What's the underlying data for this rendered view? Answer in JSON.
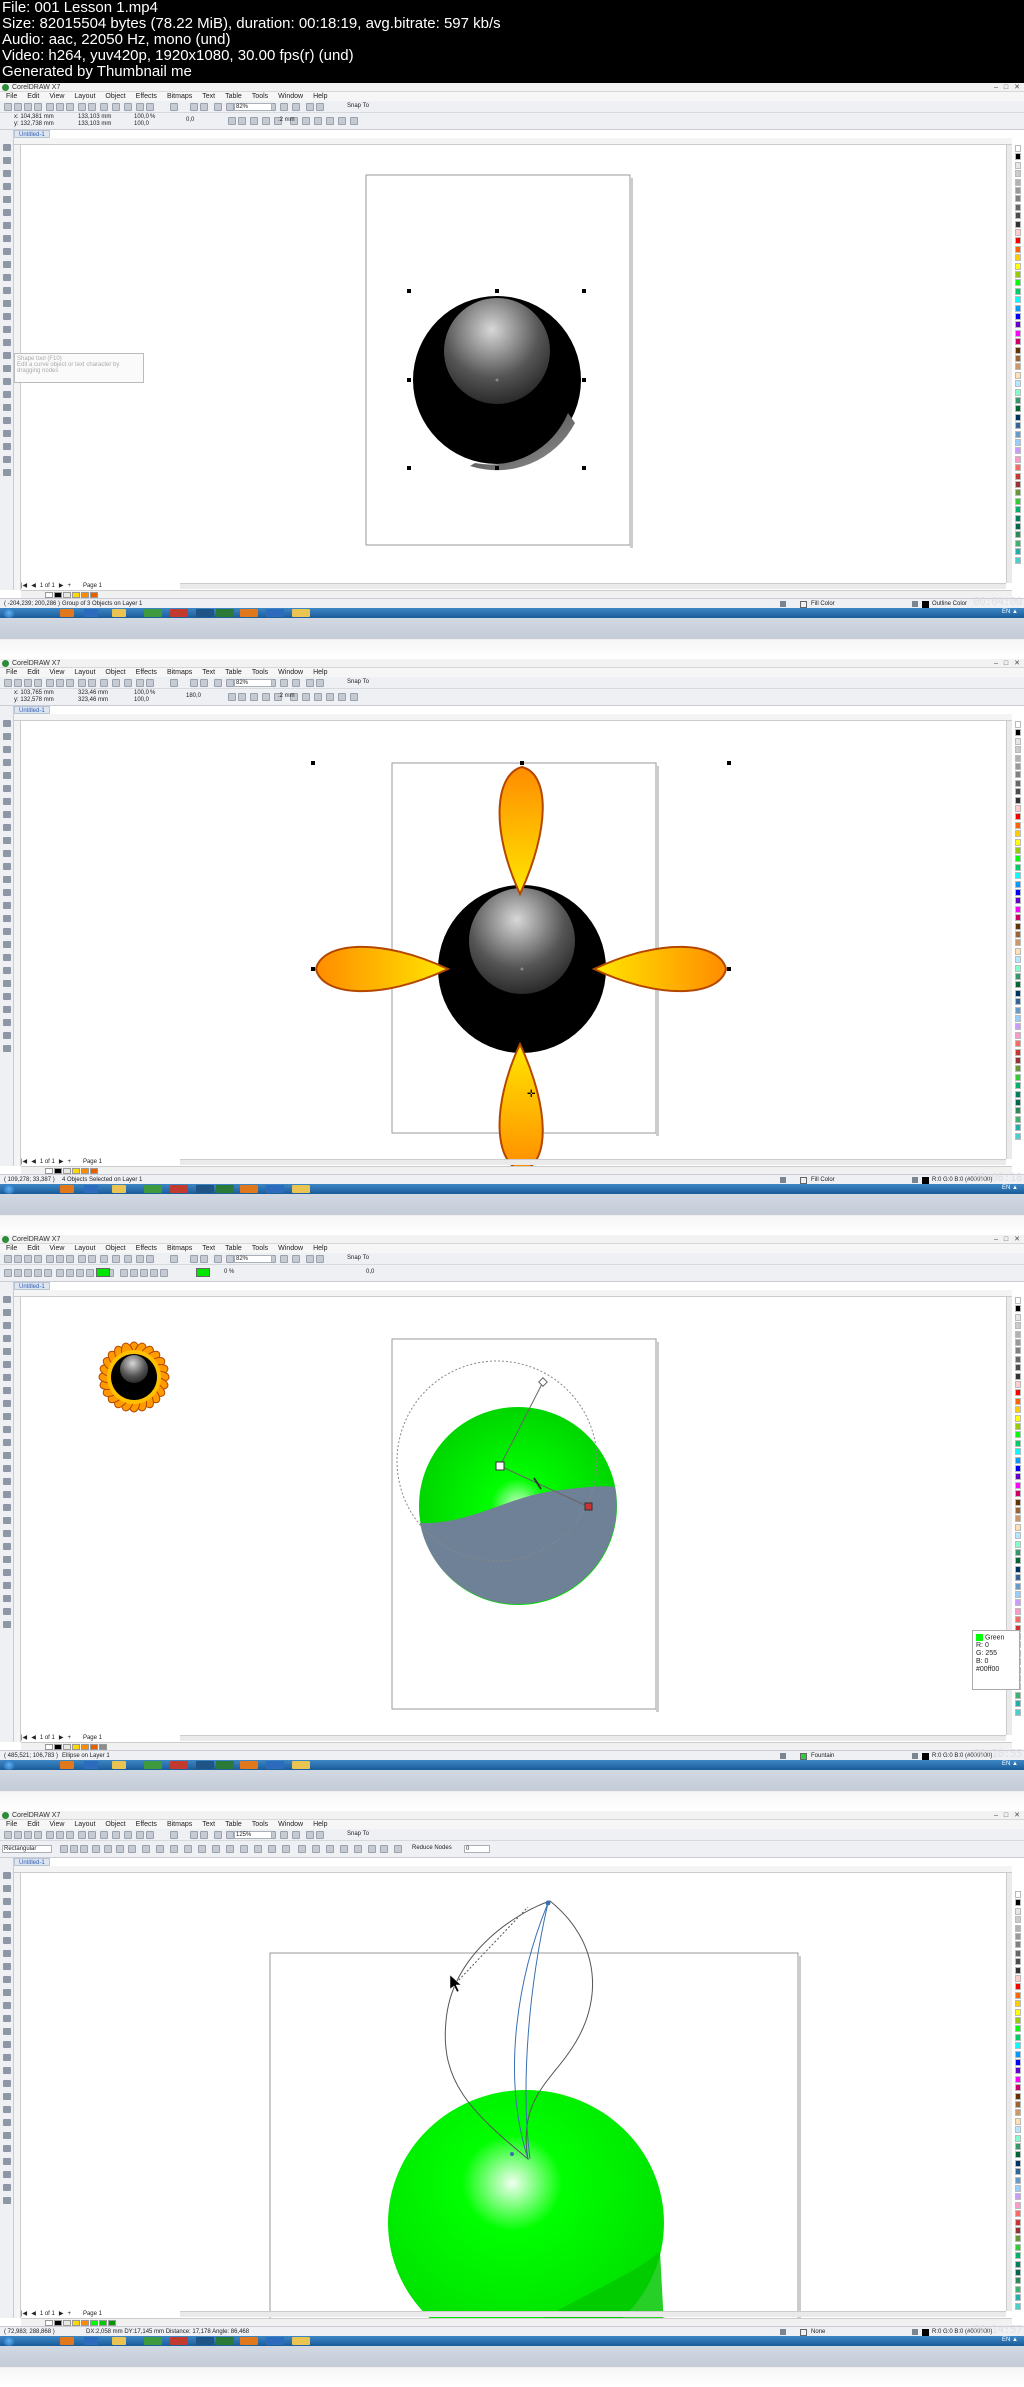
{
  "header": {
    "file": "File: 001 Lesson 1.mp4",
    "size": "Size: 82015504 bytes (78.22 MiB), duration: 00:18:19, avg.bitrate: 597 kb/s",
    "audio": "Audio: aac, 22050 Hz, mono (und)",
    "video": "Video: h264, yuv420p, 1920x1080, 30.00 fps(r) (und)",
    "generated": "Generated by Thumbnail me"
  },
  "app": {
    "title": "CorelDRAW X7",
    "menu": [
      "File",
      "Edit",
      "View",
      "Layout",
      "Object",
      "Effects",
      "Bitmaps",
      "Text",
      "Table",
      "Tools",
      "Window",
      "Help"
    ],
    "doc_tab": "Untitled-1",
    "snap": "Snap To",
    "page_counter": "1 of 1",
    "page_label": "Page 1"
  },
  "frames": [
    {
      "zoom": "82%",
      "prop": {
        "x": "x: 104,381 mm",
        "y": "y: 132,738 mm",
        "w": "133,103 mm",
        "h": "133,103 mm",
        "sx": "100,0",
        "sy": "100,0",
        "angle": "0,0",
        "outline": ".2 mm"
      },
      "status_left": "( -204,239; 200,286 )",
      "status_mid": "Group of 3 Objects on Layer 1",
      "fill": "Fill Color",
      "outline": "Outline Color",
      "timestamp": "00:04:00",
      "tooltip_title": "Shape tool (F10)",
      "tooltip_text": "Edit a curve object or text character by dragging nodes"
    },
    {
      "zoom": "82%",
      "prop": {
        "x": "x: 103,765 mm",
        "y": "y: 132,578 mm",
        "w": "323,46 mm",
        "h": "323,46 mm",
        "sx": "100,0",
        "sy": "100,0",
        "angle": "180,0",
        "outline": ".2 mm"
      },
      "status_left": "( 109,278; 33,387 )",
      "status_mid": "4 Objects Selected on Layer 1",
      "fill": "Fill Color",
      "outline": "R:0 G:0 B:0 (#000000)",
      "timestamp": "00:08:18"
    },
    {
      "zoom": "82%",
      "prop": {
        "percent": "0 %",
        "angle": "0,0"
      },
      "status_left": "( 485,521; 106,783 )",
      "status_mid": "Ellipse on Layer 1",
      "fill": "Fountain",
      "outline": "R:0 G:0 B:0 (#000000)",
      "timestamp": "00:10:55",
      "color_tip": {
        "name": "Green",
        "r": "R: 0",
        "g": "G: 255",
        "b": "B: 0",
        "hex": "#00ff00"
      }
    },
    {
      "zoom": "125%",
      "prop": {
        "shape": "Rectangular",
        "reduce": "Reduce Nodes",
        "value": "0"
      },
      "status_left": "( 72,983; 288,868 )",
      "status_mid": "DX:2,058 mm DY:17,145 mm Distance: 17,178 Angle: 86,468",
      "fill": "None",
      "outline": "R:0 G:0 B:0 (#000000)",
      "timestamp": "00:14:57"
    }
  ],
  "colors": {
    "accent": "#1b5c9b",
    "orange": "#ff8c00",
    "yellow": "#ffd800",
    "green": "#00ff00",
    "slate": "#6f8196"
  }
}
